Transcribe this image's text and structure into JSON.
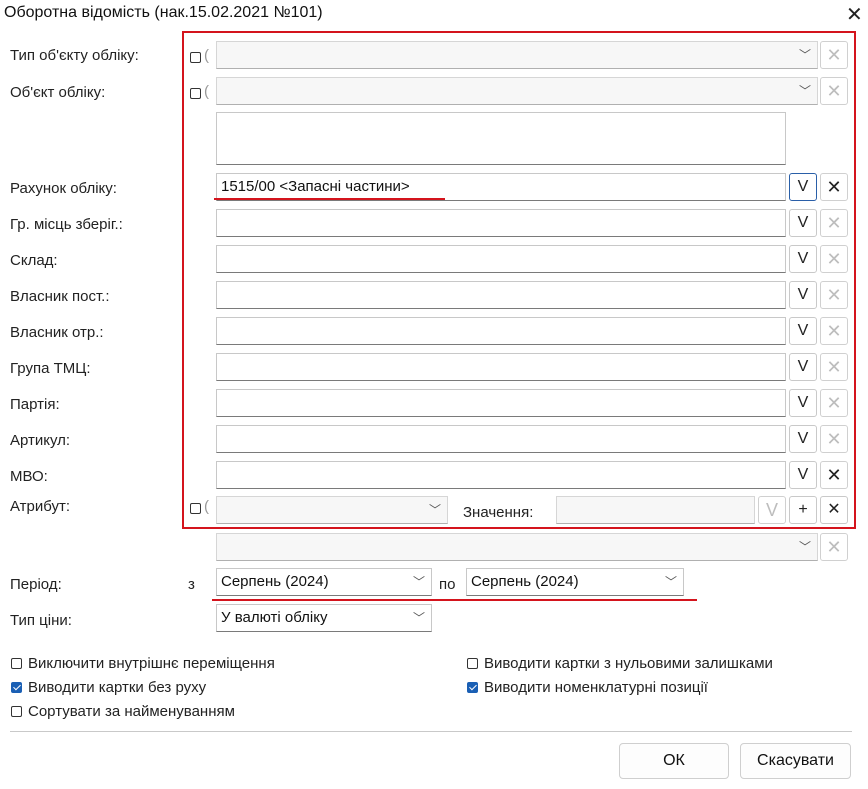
{
  "window": {
    "title": "Оборотна відомість (нак.15.02.2021 №101)",
    "close_glyph": "✕"
  },
  "fields": {
    "object_type_label": "Тип об'єкту обліку:",
    "object_label": "Об'єкт обліку:",
    "account_label": "Рахунок обліку:",
    "account_value": "1515/00 <Запасні частини>",
    "storage_group_label": "Гр. місць зберіг.:",
    "warehouse_label": "Склад:",
    "owner_sender_label": "Власник пост.:",
    "owner_receiver_label": "Власник отр.:",
    "goods_group_label": "Група ТМЦ:",
    "batch_label": "Партія:",
    "article_label": "Артикул:",
    "mvo_label": "МВО:",
    "attribute_label": "Атрибут:",
    "value_label": "Значення:"
  },
  "buttons": {
    "select_glyph": "V",
    "clear_glyph": "✕",
    "plus_glyph": "+",
    "ok": "ОК",
    "cancel": "Скасувати"
  },
  "period": {
    "label": "Період:",
    "from_label": "з",
    "from_value": "Серпень (2024)",
    "to_label": "по",
    "to_value": "Серпень (2024)"
  },
  "price_type": {
    "label": "Тип ціни:",
    "value": "У валюті обліку"
  },
  "options": [
    {
      "label": "Виключити внутрішнє переміщення",
      "checked": false
    },
    {
      "label": "Виводити картки без руху",
      "checked": true
    },
    {
      "label": "Сортувати за найменуванням",
      "checked": false
    },
    {
      "label": "Виводити картки з нульовими залишками",
      "checked": false
    },
    {
      "label": "Виводити номенклатурні позиції",
      "checked": true
    }
  ],
  "colors": {
    "highlight_red": "#d4141d",
    "checkbox_blue": "#1a5fb4",
    "focus_blue": "#2a5fa8"
  }
}
